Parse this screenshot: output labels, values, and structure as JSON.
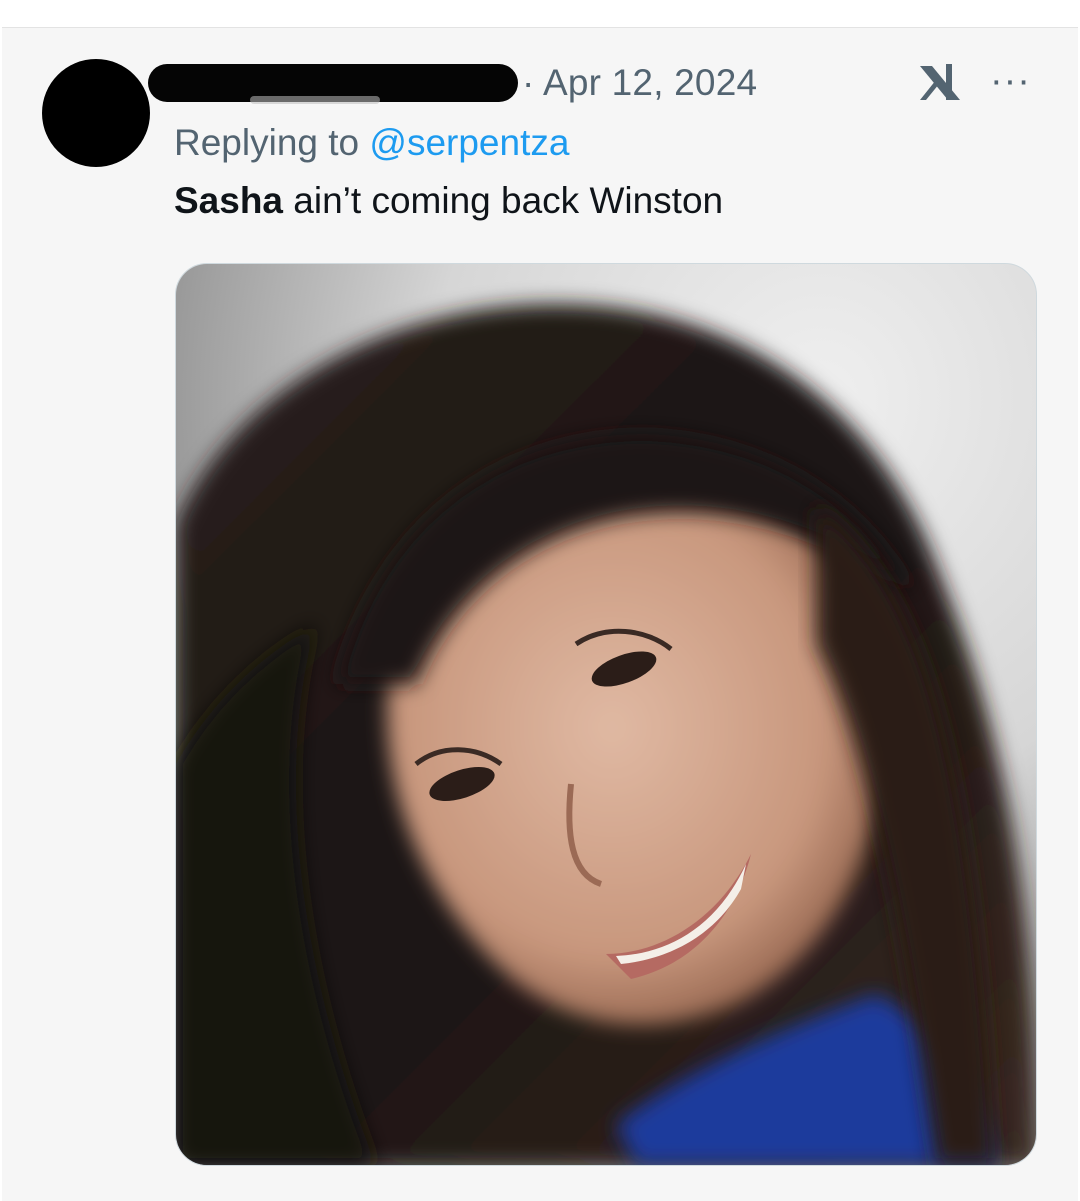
{
  "tweet": {
    "timestamp_prefix": "·",
    "date": "Apr 12, 2024",
    "replying_prefix": "Replying to",
    "replying_handle": "@serpentza",
    "text_bold": "Sasha",
    "text_rest": " ain’t coming back Winston",
    "more_label": "···",
    "media_alt": "photo of a smiling woman with long dark hair wearing a blue top"
  },
  "icons": {
    "brand": "x-logo-icon",
    "more": "more-options-icon",
    "avatar": "avatar"
  },
  "colors": {
    "background": "#f6f6f6",
    "secondary_text": "#536471",
    "primary_text": "#0f1419",
    "link": "#1d9bf0"
  }
}
